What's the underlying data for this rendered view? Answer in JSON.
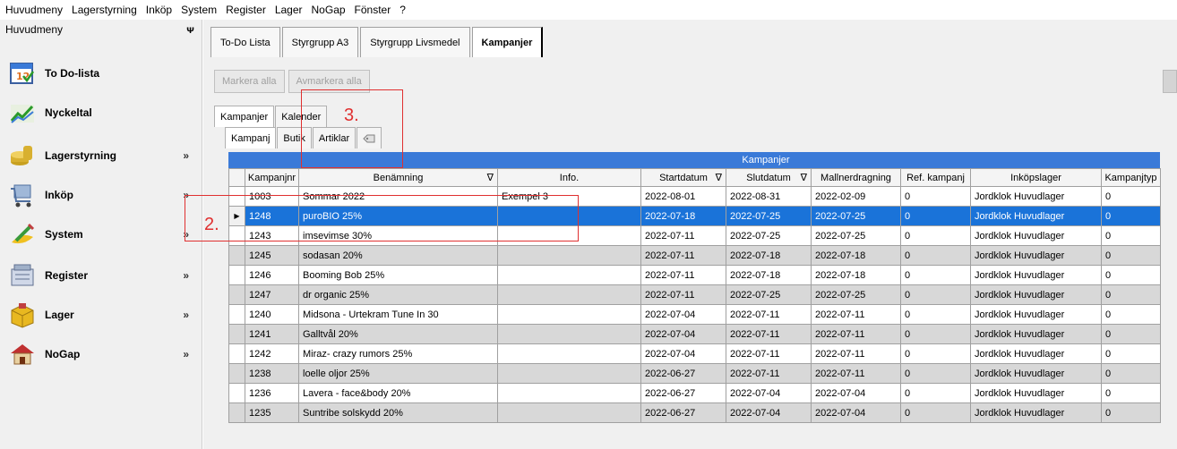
{
  "menubar": [
    "Huvudmeny",
    "Lagerstyrning",
    "Inköp",
    "System",
    "Register",
    "Lager",
    "NoGap",
    "Fönster",
    "?"
  ],
  "sidebar": {
    "title": "Huvudmeny",
    "pin": "ᴪ",
    "items": [
      {
        "label": "To Do-lista",
        "chevron": ""
      },
      {
        "label": "Nyckeltal",
        "chevron": ""
      },
      {
        "label": "Lagerstyrning",
        "chevron": "»"
      },
      {
        "label": "Inköp",
        "chevron": "»"
      },
      {
        "label": "System",
        "chevron": "»"
      },
      {
        "label": "Register",
        "chevron": "»"
      },
      {
        "label": "Lager",
        "chevron": "»"
      },
      {
        "label": "NoGap",
        "chevron": "»"
      }
    ]
  },
  "top_tabs": [
    "To-Do Lista",
    "Styrgrupp A3",
    "Styrgrupp Livsmedel",
    "Kampanjer"
  ],
  "toolbar": {
    "mark_all": "Markera alla",
    "unmark_all": "Avmarkera alla"
  },
  "mid_tabs": [
    "Kampanjer",
    "Kalender"
  ],
  "sub_tabs": [
    "Kampanj",
    "Butik",
    "Artiklar"
  ],
  "grid": {
    "title": "Kampanjer",
    "columns": [
      "Kampanjnr",
      "Benämning",
      "Info.",
      "Startdatum",
      "Slutdatum",
      "Mallnerdragning",
      "Ref. kampanj",
      "Inköpslager",
      "Kampanjtyp"
    ],
    "rows": [
      [
        "1003",
        "Sommar 2022",
        "Exempel 3",
        "2022-08-01",
        "2022-08-31",
        "2022-02-09",
        "0",
        "Jordklok Huvudlager",
        "0"
      ],
      [
        "1248",
        "puroBIO 25%",
        "",
        "2022-07-18",
        "2022-07-25",
        "2022-07-25",
        "0",
        "Jordklok Huvudlager",
        "0"
      ],
      [
        "1243",
        "imsevimse 30%",
        "",
        "2022-07-11",
        "2022-07-25",
        "2022-07-25",
        "0",
        "Jordklok Huvudlager",
        "0"
      ],
      [
        "1245",
        "sodasan 20%",
        "",
        "2022-07-11",
        "2022-07-18",
        "2022-07-18",
        "0",
        "Jordklok Huvudlager",
        "0"
      ],
      [
        "1246",
        "Booming Bob 25%",
        "",
        "2022-07-11",
        "2022-07-18",
        "2022-07-18",
        "0",
        "Jordklok Huvudlager",
        "0"
      ],
      [
        "1247",
        "dr organic 25%",
        "",
        "2022-07-11",
        "2022-07-25",
        "2022-07-25",
        "0",
        "Jordklok Huvudlager",
        "0"
      ],
      [
        "1240",
        "Midsona - Urtekram Tune In 30",
        "",
        "2022-07-04",
        "2022-07-11",
        "2022-07-11",
        "0",
        "Jordklok Huvudlager",
        "0"
      ],
      [
        "1241",
        "Galltvål 20%",
        "",
        "2022-07-04",
        "2022-07-11",
        "2022-07-11",
        "0",
        "Jordklok Huvudlager",
        "0"
      ],
      [
        "1242",
        "Miraz- crazy rumors 25%",
        "",
        "2022-07-04",
        "2022-07-11",
        "2022-07-11",
        "0",
        "Jordklok Huvudlager",
        "0"
      ],
      [
        "1238",
        "loelle oljor 25%",
        "",
        "2022-06-27",
        "2022-07-11",
        "2022-07-11",
        "0",
        "Jordklok Huvudlager",
        "0"
      ],
      [
        "1236",
        "Lavera - face&body 20%",
        "",
        "2022-06-27",
        "2022-07-04",
        "2022-07-04",
        "0",
        "Jordklok Huvudlager",
        "0"
      ],
      [
        "1235",
        "Suntribe solskydd 20%",
        "",
        "2022-06-27",
        "2022-07-04",
        "2022-07-04",
        "0",
        "Jordklok Huvudlager",
        "0"
      ]
    ]
  },
  "annotations": {
    "n2": "2.",
    "n3": "3."
  },
  "colors": {
    "accent": "#1a73d9",
    "header_bar": "#3a7ad8",
    "annotation": "#e03030"
  }
}
